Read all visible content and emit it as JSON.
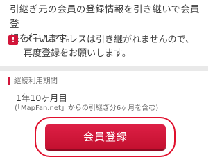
{
  "intro": {
    "line1": "引継ぎ元の会員の登録情報を引き継いで会員登",
    "line2": "録を行います。"
  },
  "warning": {
    "icon_glyph": "!",
    "line1": "メールアドレスは引き継がれませんので、",
    "line2": "再度登録をお願いします。",
    "color": "#d2163a"
  },
  "section": {
    "title": "継続利用期間"
  },
  "duration": {
    "value": "1年10ヶ月目",
    "note": "(「MapFan.net」からの引継ぎ分6ヶ月を含む)"
  },
  "register_button": {
    "label": "会員登録",
    "color": "#d2163a",
    "highlight_color": "#e0102d"
  }
}
